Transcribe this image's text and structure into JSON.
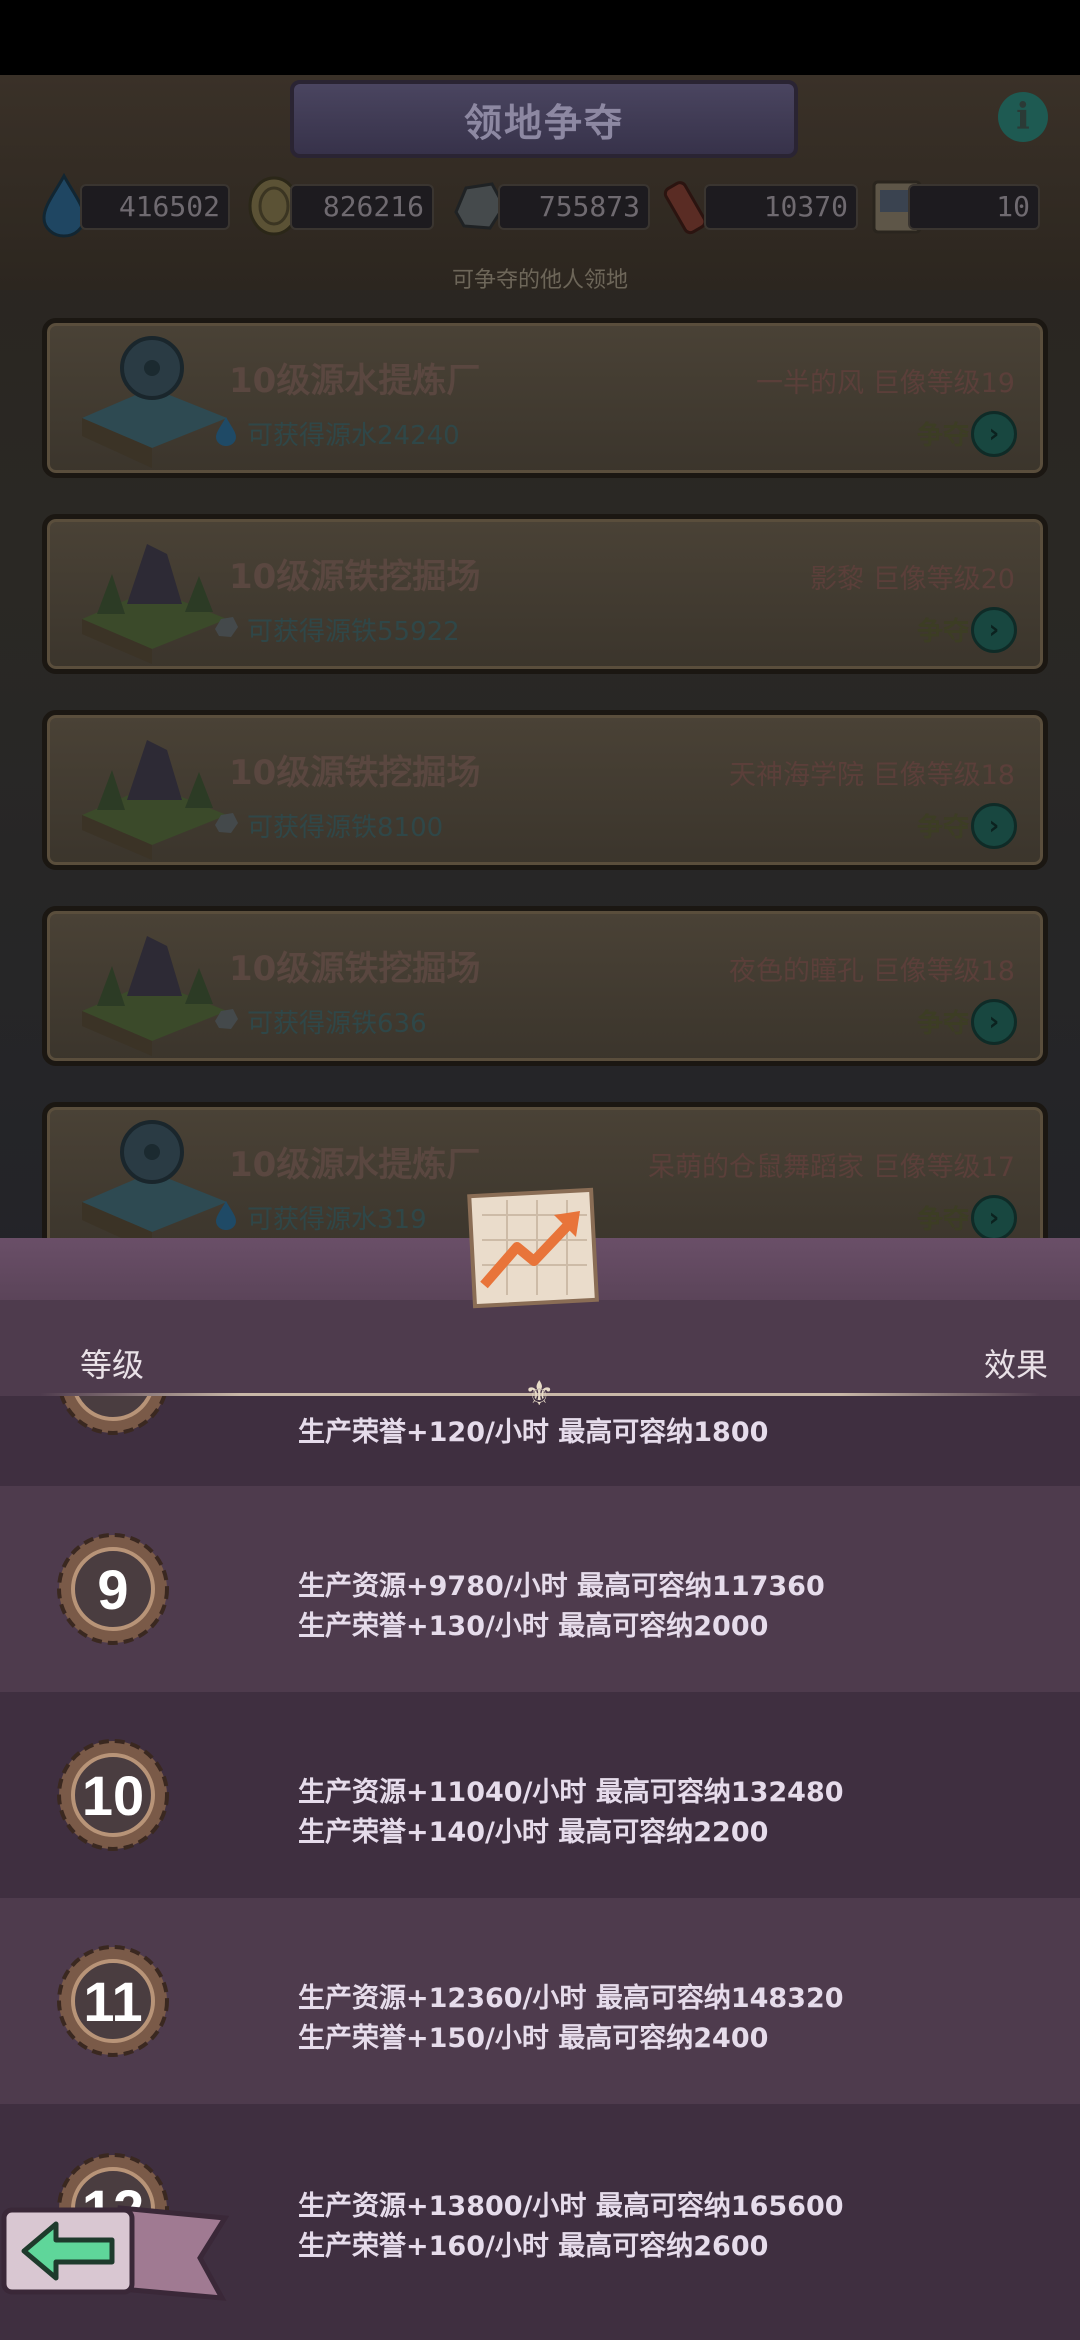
{
  "header": {
    "title": "领地争夺",
    "subtitle": "可争夺的他人领地"
  },
  "resources": [
    {
      "icon": "water-drop-icon",
      "value": "416502"
    },
    {
      "icon": "gold-coin-icon",
      "value": "826216"
    },
    {
      "icon": "iron-ore-icon",
      "value": "755873"
    },
    {
      "icon": "scroll-icon",
      "value": "10370"
    },
    {
      "icon": "ticket-icon",
      "value": "10"
    }
  ],
  "territories": [
    {
      "name": "10级源水提炼厂",
      "gain": "可获得源水24240",
      "owner": "一半的风  巨像等级19",
      "action": "争夺",
      "type": "water"
    },
    {
      "name": "10级源铁挖掘场",
      "gain": "可获得源铁55922",
      "owner": "影黎  巨像等级20",
      "action": "争夺",
      "type": "iron"
    },
    {
      "name": "10级源铁挖掘场",
      "gain": "可获得源铁8100",
      "owner": "天神海学院  巨像等级18",
      "action": "争夺",
      "type": "iron"
    },
    {
      "name": "10级源铁挖掘场",
      "gain": "可获得源铁636",
      "owner": "夜色的瞳孔  巨像等级18",
      "action": "争夺",
      "type": "iron"
    },
    {
      "name": "10级源水提炼厂",
      "gain": "可获得源水319",
      "owner": "呆萌的仓鼠舞蹈家  巨像等级17",
      "action": "争夺",
      "type": "water"
    }
  ],
  "panel": {
    "col_level": "等级",
    "col_effect": "效果",
    "partial_top_line": "生产荣誉+120/小时  最高可容纳1800",
    "levels": [
      {
        "level": "9",
        "line1": "生产资源+9780/小时  最高可容纳117360",
        "line2": "生产荣誉+130/小时  最高可容纳2000"
      },
      {
        "level": "10",
        "line1": "生产资源+11040/小时  最高可容纳132480",
        "line2": "生产荣誉+140/小时  最高可容纳2200"
      },
      {
        "level": "11",
        "line1": "生产资源+12360/小时  最高可容纳148320",
        "line2": "生产荣誉+150/小时  最高可容纳2400"
      },
      {
        "level": "12",
        "line1": "生产资源+13800/小时  最高可容纳165600",
        "line2": "生产荣誉+160/小时  最高可容纳2600"
      }
    ]
  },
  "colors": {
    "panel_bg": "#4d3a4c",
    "row_dark": "#3f2f40",
    "text": "#e6dceb",
    "accent_orange": "#e8743a"
  }
}
